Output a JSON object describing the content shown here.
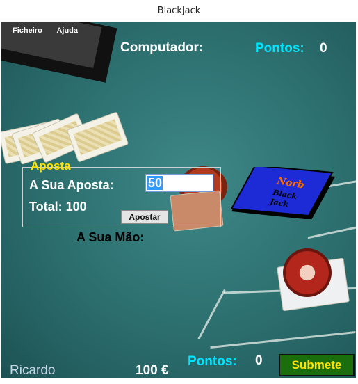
{
  "window": {
    "title": "BlackJack"
  },
  "menu": {
    "file": "Ficheiro",
    "help": "Ajuda"
  },
  "computer": {
    "label": "Computador:",
    "points_label": "Pontos:",
    "points_value": "0"
  },
  "bet": {
    "legend": "Aposta",
    "your_bet_label": "A Sua Aposta:",
    "bet_value": "50",
    "total_label": "Total: 100",
    "bet_button": "Apostar"
  },
  "deck": {
    "logo_line1": "Norb",
    "logo_line2": "Black",
    "logo_line3": "Jack"
  },
  "hand": {
    "label": "A Sua Mão:"
  },
  "player": {
    "name": "Ricardo",
    "money": "100 €",
    "points_label": "Pontos:",
    "points_value": "0",
    "submit_button": "Submete"
  },
  "colors": {
    "accent_cyan": "#00e5ff",
    "accent_yellow": "#ffe200",
    "felt": "#2f7373",
    "submit_bg": "#1a6e0c"
  }
}
